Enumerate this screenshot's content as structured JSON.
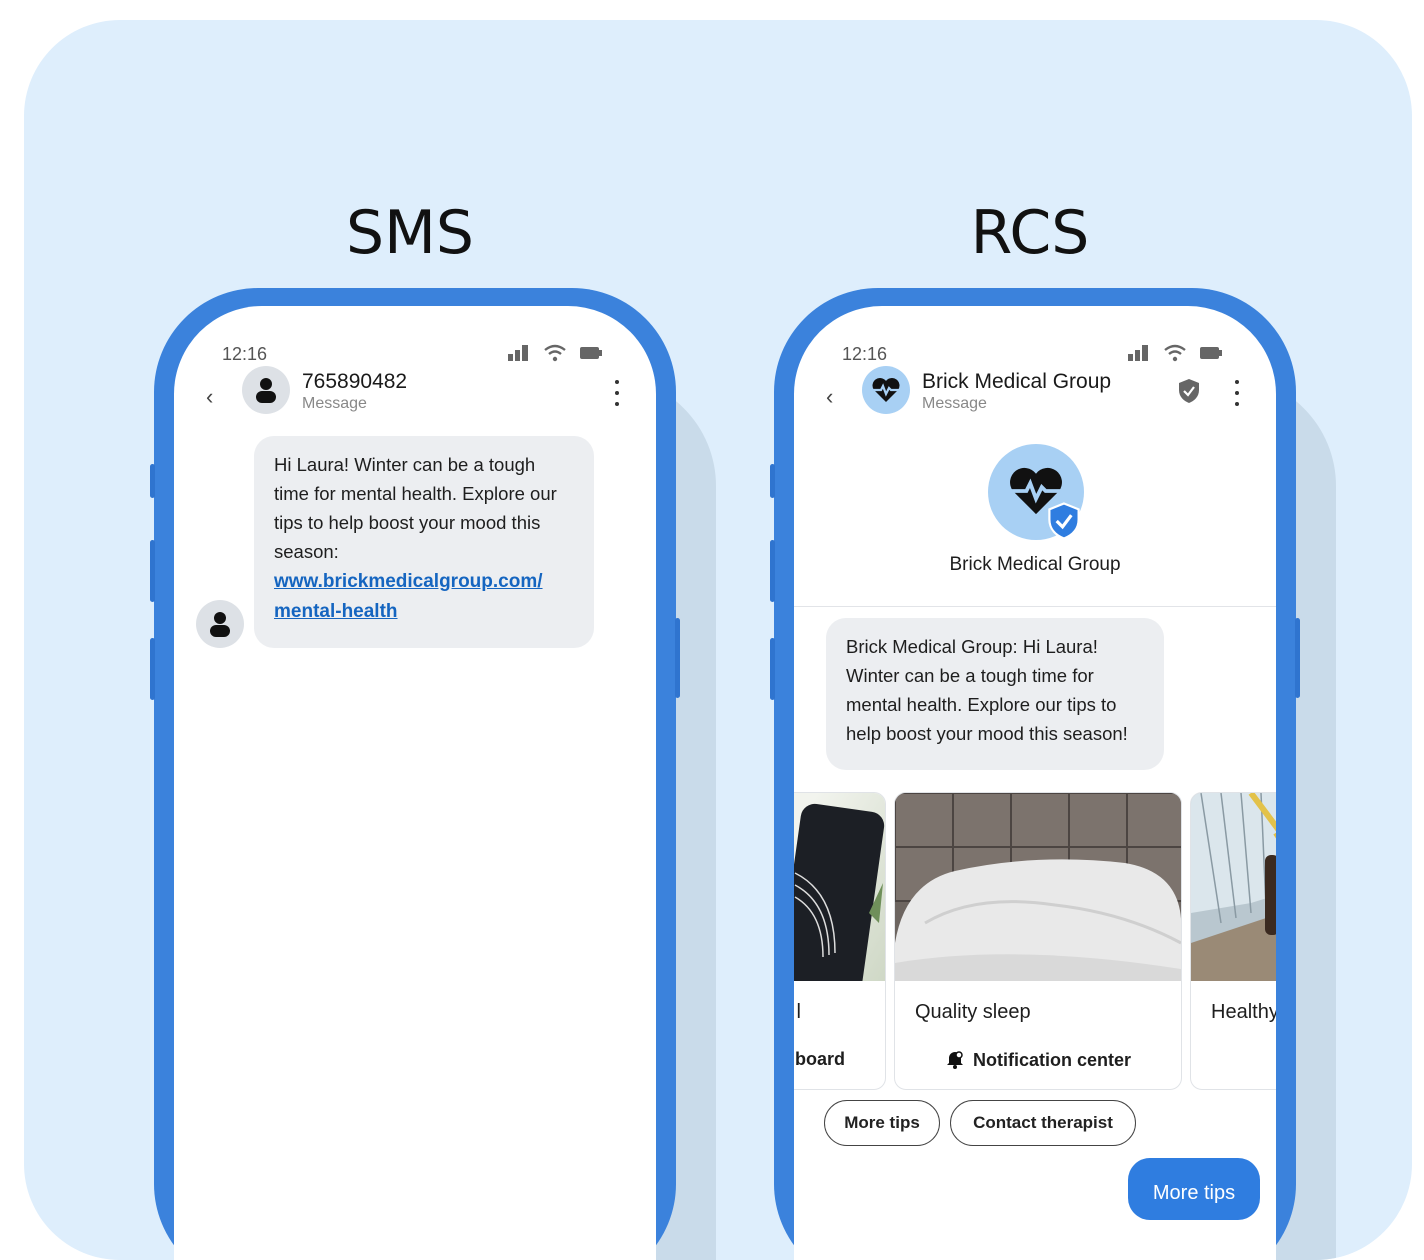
{
  "sms": {
    "heading": "SMS",
    "status_time": "12:16",
    "contact": "765890482",
    "subtitle": "Message",
    "message": "Hi Laura! Winter can be a tough time for mental health. Explore our tips to help boost your mood this season:",
    "link_line1": "www.brickmedicalgroup.com/",
    "link_line2": "mental-health"
  },
  "rcs": {
    "heading": "RCS",
    "status_time": "12:16",
    "contact": "Brick Medical Group",
    "subtitle": "Message",
    "profile_name": "Brick Medical Group",
    "message": "Brick Medical Group: Hi Laura! Winter can be a tough time for mental health. Explore our tips to help boost your mood this season!",
    "cards": [
      {
        "title": "l",
        "action": "board"
      },
      {
        "title": "Quality sleep",
        "action": "Notification center"
      },
      {
        "title": "Healthy",
        "action": "("
      }
    ],
    "chips": [
      "More tips",
      "Contact therapist"
    ],
    "sent_message": "More tips"
  },
  "colors": {
    "background_panel": "#deeefc",
    "phone_frame": "#3b82dc",
    "bubble": "#eceef1",
    "link": "#1565c0",
    "sent_bubble": "#2f7de0"
  }
}
